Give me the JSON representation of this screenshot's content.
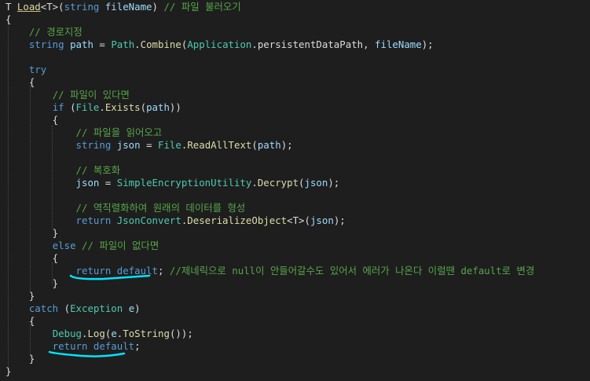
{
  "colors": {
    "background": "#1e1e1e",
    "keyword": "#569cd6",
    "type": "#4ec9b0",
    "method": "#dcdcaa",
    "comment": "#57a64a",
    "parameter": "#9cdcfe",
    "default_text": "#dcdcdc",
    "annotation": "#00e5ff"
  },
  "code": {
    "lines": [
      [
        {
          "t": "T ",
          "c": "d"
        },
        {
          "t": "Load",
          "c": "m",
          "u": true
        },
        {
          "t": "<T>(",
          "c": "d"
        },
        {
          "t": "string",
          "c": "k"
        },
        {
          "t": " ",
          "c": "d"
        },
        {
          "t": "fileName",
          "c": "p"
        },
        {
          "t": ") ",
          "c": "d"
        },
        {
          "t": "// 파일 불러오기",
          "c": "c"
        }
      ],
      [
        {
          "t": "{",
          "c": "d"
        }
      ],
      [
        {
          "t": "    ",
          "c": "d"
        },
        {
          "t": "// 경로지정",
          "c": "c"
        }
      ],
      [
        {
          "t": "    ",
          "c": "d"
        },
        {
          "t": "string",
          "c": "k"
        },
        {
          "t": " ",
          "c": "d"
        },
        {
          "t": "path",
          "c": "p"
        },
        {
          "t": " = ",
          "c": "d"
        },
        {
          "t": "Path",
          "c": "t"
        },
        {
          "t": ".",
          "c": "d"
        },
        {
          "t": "Combine",
          "c": "m"
        },
        {
          "t": "(",
          "c": "d"
        },
        {
          "t": "Application",
          "c": "t"
        },
        {
          "t": ".persistentDataPath, ",
          "c": "d"
        },
        {
          "t": "fileName",
          "c": "p"
        },
        {
          "t": ");",
          "c": "d"
        }
      ],
      [],
      [
        {
          "t": "    ",
          "c": "d"
        },
        {
          "t": "try",
          "c": "k"
        }
      ],
      [
        {
          "t": "    {",
          "c": "d"
        }
      ],
      [
        {
          "t": "        ",
          "c": "d"
        },
        {
          "t": "// 파일이 있다면",
          "c": "c"
        }
      ],
      [
        {
          "t": "        ",
          "c": "d"
        },
        {
          "t": "if",
          "c": "k"
        },
        {
          "t": " (",
          "c": "d"
        },
        {
          "t": "File",
          "c": "t"
        },
        {
          "t": ".",
          "c": "d"
        },
        {
          "t": "Exists",
          "c": "m"
        },
        {
          "t": "(",
          "c": "d"
        },
        {
          "t": "path",
          "c": "p"
        },
        {
          "t": "))",
          "c": "d"
        }
      ],
      [
        {
          "t": "        {",
          "c": "d"
        }
      ],
      [
        {
          "t": "            ",
          "c": "d"
        },
        {
          "t": "// 파일을 읽어오고",
          "c": "c"
        }
      ],
      [
        {
          "t": "            ",
          "c": "d"
        },
        {
          "t": "string",
          "c": "k"
        },
        {
          "t": " ",
          "c": "d"
        },
        {
          "t": "json",
          "c": "p"
        },
        {
          "t": " = ",
          "c": "d"
        },
        {
          "t": "File",
          "c": "t"
        },
        {
          "t": ".",
          "c": "d"
        },
        {
          "t": "ReadAllText",
          "c": "m"
        },
        {
          "t": "(",
          "c": "d"
        },
        {
          "t": "path",
          "c": "p"
        },
        {
          "t": ");",
          "c": "d"
        }
      ],
      [],
      [
        {
          "t": "            ",
          "c": "d"
        },
        {
          "t": "// 복호화",
          "c": "c"
        }
      ],
      [
        {
          "t": "            ",
          "c": "d"
        },
        {
          "t": "json",
          "c": "p"
        },
        {
          "t": " = ",
          "c": "d"
        },
        {
          "t": "SimpleEncryptionUtility",
          "c": "t"
        },
        {
          "t": ".",
          "c": "d"
        },
        {
          "t": "Decrypt",
          "c": "m"
        },
        {
          "t": "(",
          "c": "d"
        },
        {
          "t": "json",
          "c": "p"
        },
        {
          "t": ");",
          "c": "d"
        }
      ],
      [],
      [
        {
          "t": "            ",
          "c": "d"
        },
        {
          "t": "// 역직렬화하여 원래의 데이터를 형성",
          "c": "c"
        }
      ],
      [
        {
          "t": "            ",
          "c": "d"
        },
        {
          "t": "return",
          "c": "k"
        },
        {
          "t": " ",
          "c": "d"
        },
        {
          "t": "JsonConvert",
          "c": "t"
        },
        {
          "t": ".",
          "c": "d"
        },
        {
          "t": "DeserializeObject",
          "c": "m"
        },
        {
          "t": "<T>(",
          "c": "d"
        },
        {
          "t": "json",
          "c": "p"
        },
        {
          "t": ");",
          "c": "d"
        }
      ],
      [
        {
          "t": "        }",
          "c": "d"
        }
      ],
      [
        {
          "t": "        ",
          "c": "d"
        },
        {
          "t": "else",
          "c": "k"
        },
        {
          "t": " ",
          "c": "d"
        },
        {
          "t": "// 파일이 없다면",
          "c": "c"
        }
      ],
      [
        {
          "t": "        {",
          "c": "d"
        }
      ],
      [
        {
          "t": "            ",
          "c": "d"
        },
        {
          "t": "return",
          "c": "k"
        },
        {
          "t": " ",
          "c": "d"
        },
        {
          "t": "default",
          "c": "k"
        },
        {
          "t": "; ",
          "c": "d"
        },
        {
          "t": "//제네릭으로 null이 안들어갈수도 있어서 에러가 나온다 이럴땐 default로 변경",
          "c": "c"
        }
      ],
      [
        {
          "t": "        }",
          "c": "d"
        }
      ],
      [
        {
          "t": "    }",
          "c": "d"
        }
      ],
      [
        {
          "t": "    ",
          "c": "d"
        },
        {
          "t": "catch",
          "c": "k"
        },
        {
          "t": " (",
          "c": "d"
        },
        {
          "t": "Exception",
          "c": "t"
        },
        {
          "t": " ",
          "c": "d"
        },
        {
          "t": "e",
          "c": "p"
        },
        {
          "t": ")",
          "c": "d"
        }
      ],
      [
        {
          "t": "    {",
          "c": "d"
        }
      ],
      [
        {
          "t": "        ",
          "c": "d"
        },
        {
          "t": "Debug",
          "c": "t"
        },
        {
          "t": ".",
          "c": "d"
        },
        {
          "t": "Log",
          "c": "m"
        },
        {
          "t": "(",
          "c": "d"
        },
        {
          "t": "e",
          "c": "p"
        },
        {
          "t": ".",
          "c": "d"
        },
        {
          "t": "ToString",
          "c": "m"
        },
        {
          "t": "());",
          "c": "d"
        }
      ],
      [
        {
          "t": "        ",
          "c": "d"
        },
        {
          "t": "return",
          "c": "k"
        },
        {
          "t": " ",
          "c": "d"
        },
        {
          "t": "default",
          "c": "k"
        },
        {
          "t": ";",
          "c": "d"
        }
      ],
      [
        {
          "t": "    }",
          "c": "d"
        }
      ],
      [
        {
          "t": "}",
          "c": "d"
        }
      ]
    ]
  }
}
